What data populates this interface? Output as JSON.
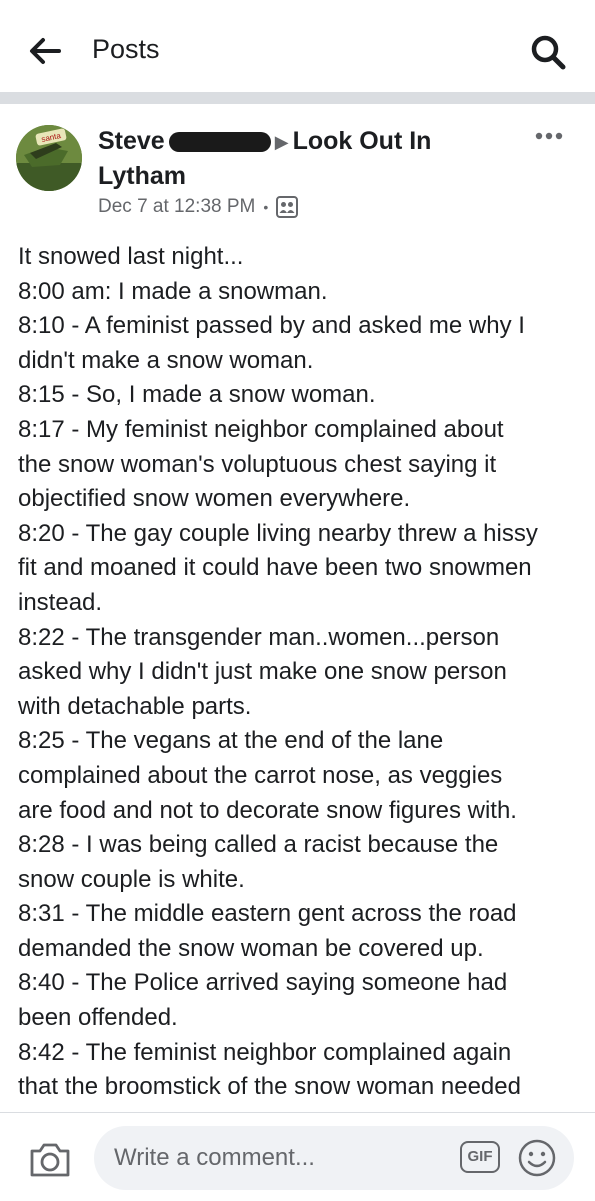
{
  "topbar": {
    "title": "Posts",
    "back_icon": "arrow-left-icon",
    "search_icon": "search-icon"
  },
  "post": {
    "author_first": "Steve",
    "group_name": "Look Out In",
    "group_name_2": "Lytham",
    "arrow": "▶",
    "timestamp": "Dec 7 at 12:38 PM",
    "meta_dot": "•",
    "audience_icon": "group-privacy-icon",
    "avatar_badge": "santa",
    "more_icon": "more-options-icon",
    "body_lines": [
      "It snowed last night...",
      "8:00 am: I made a snowman.",
      "8:10 - A feminist passed by and asked me why I",
      "didn't make a snow woman.",
      "8:15 - So, I made a snow woman.",
      "8:17 - My feminist neighbor complained about",
      "the snow woman's voluptuous chest saying it",
      "objectified snow women everywhere.",
      "8:20 - The gay couple living nearby threw a hissy",
      "fit and moaned it could have been two snowmen",
      "instead.",
      "8:22 - The transgender man..women...person",
      "asked why I didn't just make one snow person",
      "with detachable parts.",
      "8:25 - The vegans at the end of the lane",
      "complained about the carrot nose, as veggies",
      "are food and not to decorate snow figures with.",
      "8:28 - I was being called a racist because the",
      "snow couple is white.",
      "8:31 - The middle eastern gent across the road",
      "demanded the snow woman be covered up.",
      "8:40 - The Police arrived saying someone had",
      "been offended.",
      "8:42 - The feminist neighbor complained again",
      "that the broomstick of the snow woman needed"
    ]
  },
  "comment_bar": {
    "placeholder": "Write a comment...",
    "gif_label": "GIF",
    "camera_icon": "camera-icon",
    "emoji_icon": "emoji-icon"
  },
  "colors": {
    "text": "#1c1e21",
    "secondary": "#65676b",
    "divider": "#dadde1",
    "input_bg": "#f0f2f5"
  }
}
